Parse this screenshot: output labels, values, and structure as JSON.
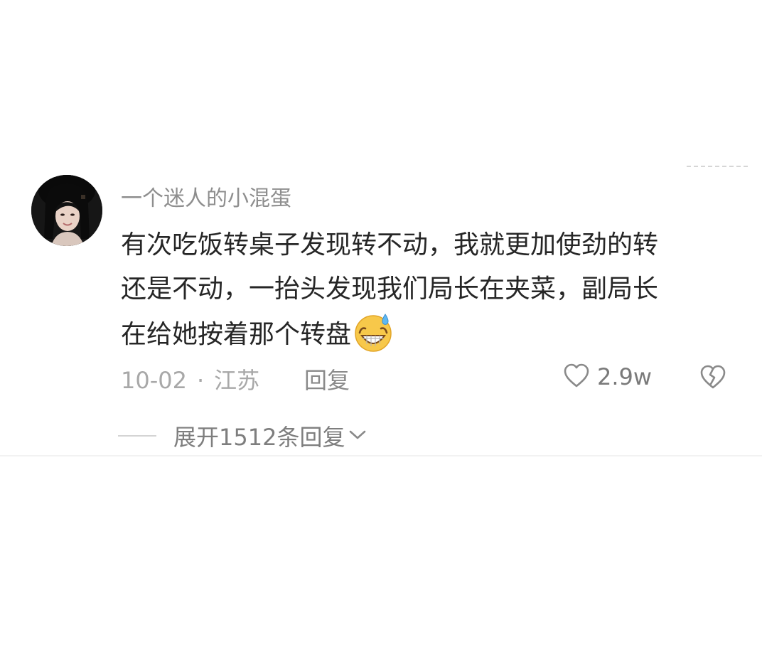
{
  "comment": {
    "username": "一个迷人的小混蛋",
    "content_lines": [
      "有次吃饭转桌子发现转不动，我就更加使劲的转",
      "还是不动，一抬头发现我们局长在夹菜，副局长",
      "在给她按着那个转盘"
    ],
    "content_emoji": "grinning-sweat-emoji",
    "date": "10-02",
    "separator": "·",
    "location": "江苏",
    "reply_label": "回复",
    "like_count": "2.9w",
    "like_icon": "heart-outline-icon",
    "dislike_icon": "broken-heart-icon",
    "expand_label": "展开1512条回复",
    "expand_icon": "chevron-down-icon"
  },
  "colors": {
    "text_primary": "#262626",
    "text_secondary": "#8e8e8e",
    "text_meta": "#a8a8a8",
    "background": "#ffffff"
  }
}
